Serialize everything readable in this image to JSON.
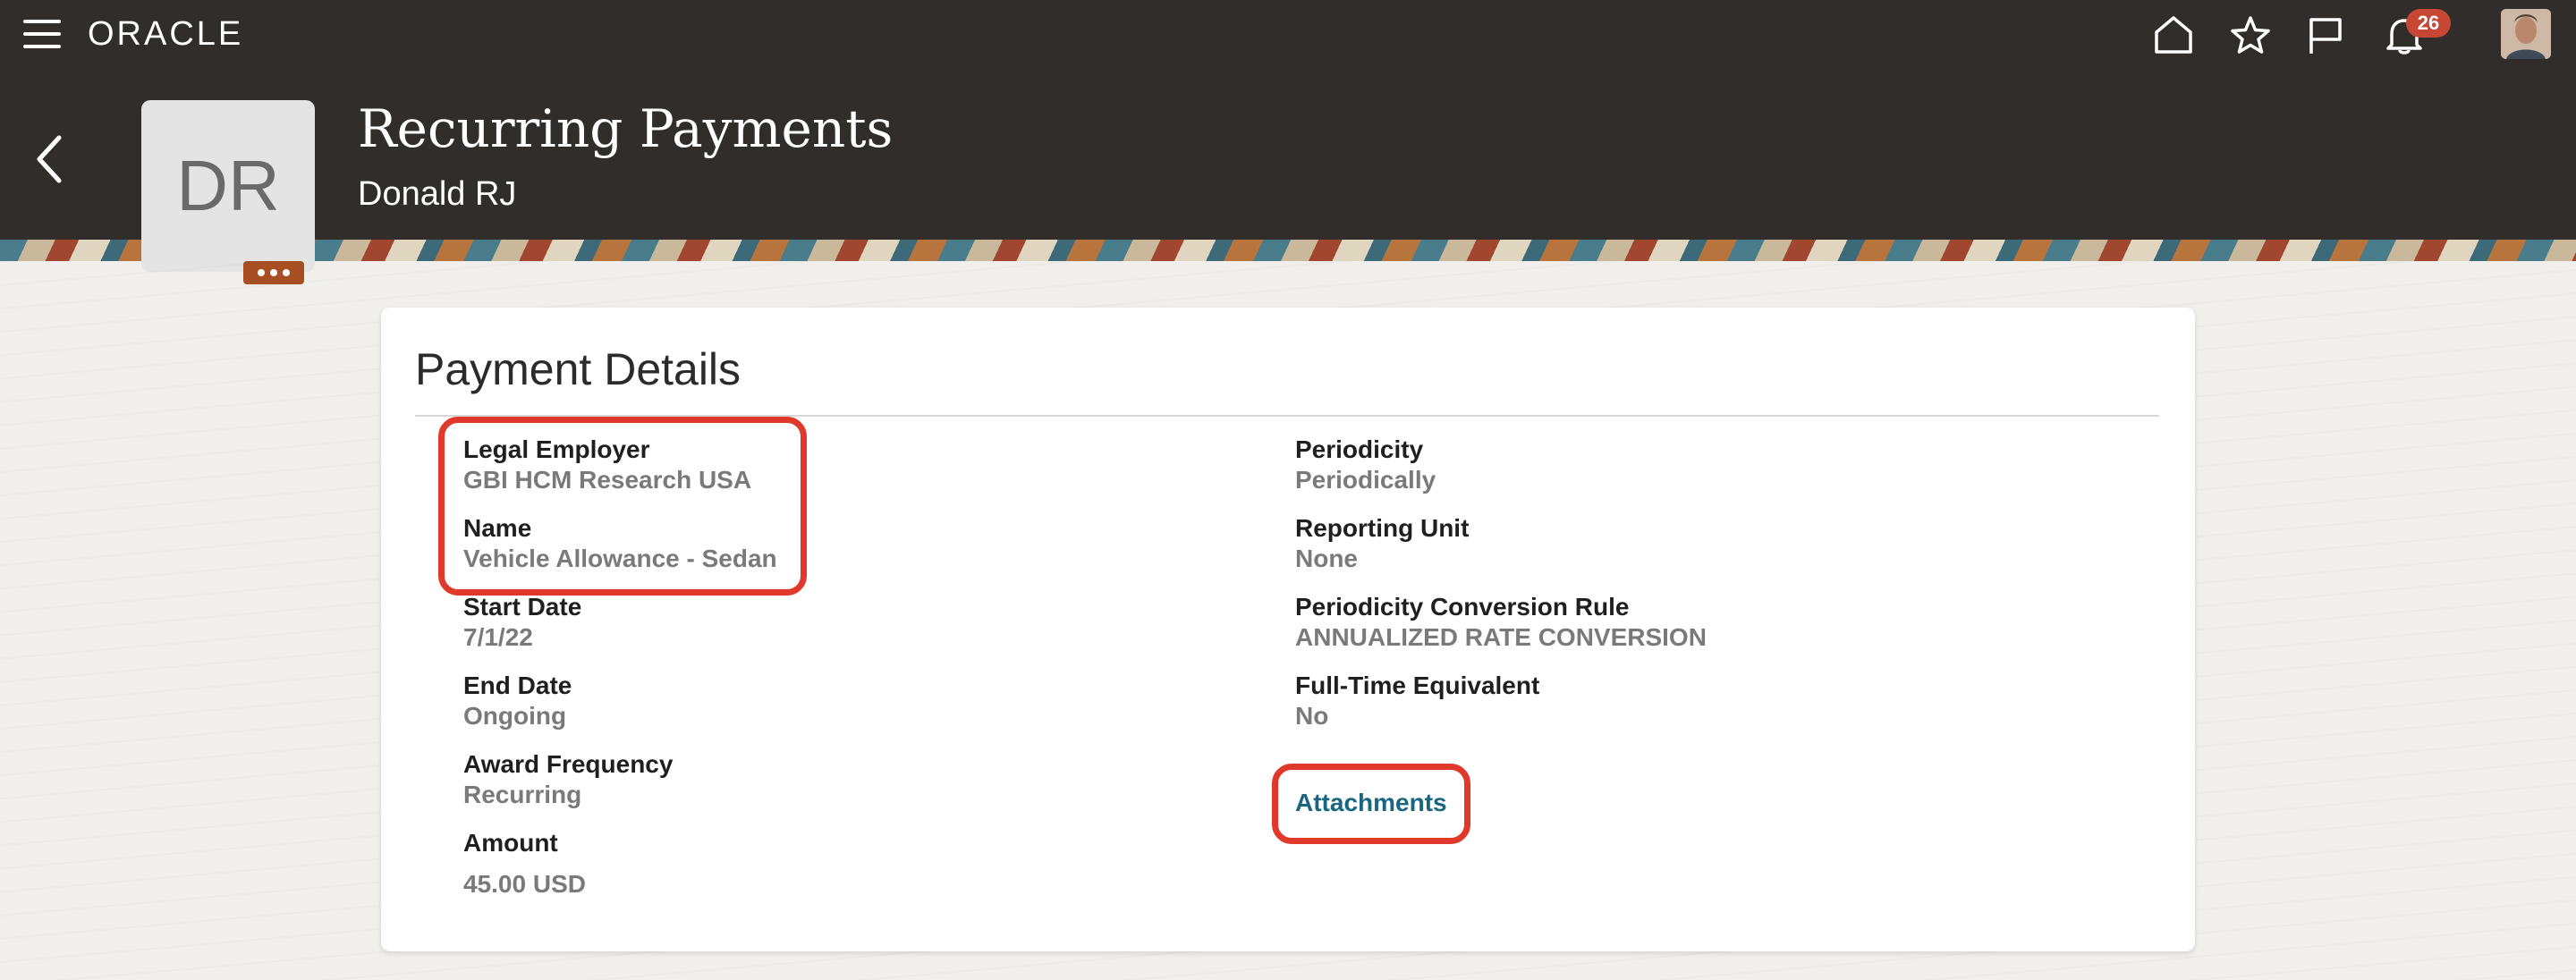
{
  "global_header": {
    "brand": "ORACLE",
    "notification_count": "26",
    "icons": [
      "menu-icon",
      "home-icon",
      "star-icon",
      "flag-icon",
      "bell-icon"
    ]
  },
  "header": {
    "title": "Recurring Payments",
    "subtitle": "Donald RJ",
    "initials": "DR"
  },
  "card": {
    "title": "Payment Details",
    "left_fields": [
      {
        "label": "Legal Employer",
        "value": "GBI HCM Research USA"
      },
      {
        "label": "Name",
        "value": "Vehicle Allowance - Sedan"
      },
      {
        "label": "Start Date",
        "value": "7/1/22"
      },
      {
        "label": "End Date",
        "value": "Ongoing"
      },
      {
        "label": "Award Frequency",
        "value": "Recurring"
      },
      {
        "label": "Amount",
        "value": "45.00 USD"
      }
    ],
    "right_fields": [
      {
        "label": "Periodicity",
        "value": "Periodically"
      },
      {
        "label": "Reporting Unit",
        "value": "None"
      },
      {
        "label": "Periodicity Conversion Rule",
        "value": "ANNUALIZED RATE CONVERSION"
      },
      {
        "label": "Full-Time Equivalent",
        "value": "No"
      }
    ],
    "attachments_label": "Attachments"
  },
  "colors": {
    "header_bg": "#312d2a",
    "highlight": "#e0392b",
    "link": "#1a6680",
    "badge": "#c74634"
  }
}
